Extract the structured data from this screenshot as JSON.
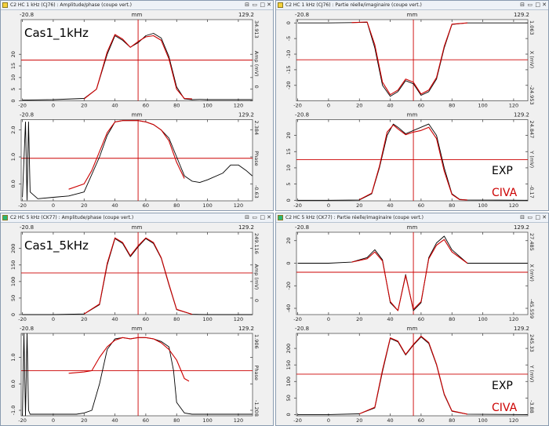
{
  "windows": [
    {
      "title": "C2 HC 1 kHz (CJ76) : Amplitude/phase (coupe vert.)",
      "icon_color": "#f5d13c",
      "panels": [
        {
          "xmin": "-20.8",
          "xunit": "mm",
          "xmax": "129.2",
          "ytop": "34.913",
          "ybottom": "0",
          "yname": "Amp (mV)",
          "yticks": [
            "20",
            "15",
            "10",
            "5",
            "0"
          ],
          "xticks": [
            "-20",
            "0",
            "20",
            "40",
            "60",
            "80",
            "100",
            "120"
          ],
          "annotation": "Cas1_1kHz",
          "annotation_color": "#000000"
        },
        {
          "xmin": "-20.8",
          "xunit": "mm",
          "xmax": "129.2",
          "ytop": "2.384",
          "ybottom": "-0.63",
          "yname": "Phase",
          "yticks": [
            "2.0",
            "1.0",
            "0.0"
          ],
          "xticks": [
            "-20",
            "0",
            "20",
            "40",
            "60",
            "80",
            "100",
            "120"
          ]
        }
      ]
    },
    {
      "title": "C2 HC 1 kHz (CJ76) : Partie réelle/imaginaire (coupe vert.)",
      "icon_color": "#f5d13c",
      "panels": [
        {
          "xmin": "-20.8",
          "xunit": "mm",
          "xmax": "129.2",
          "ytop": "1.063",
          "ybottom": "-24.953",
          "yname": "X (mV)",
          "yticks": [
            "0",
            "-5",
            "-10",
            "-15",
            "-20"
          ],
          "xticks": [
            "-20",
            "0",
            "20",
            "40",
            "60",
            "80",
            "100",
            "120"
          ]
        },
        {
          "xmin": "-20.8",
          "xunit": "mm",
          "xmax": "129.2",
          "ytop": "24.847",
          "ybottom": "-0.17",
          "yname": "Y (mV)",
          "yticks": [
            "20",
            "15",
            "10",
            "5",
            "0"
          ],
          "xticks": [
            "-20",
            "0",
            "20",
            "40",
            "60",
            "80",
            "100",
            "120"
          ],
          "legend_exp": "EXP",
          "legend_civa": "CIVA"
        }
      ]
    },
    {
      "title": "C2 HC 5 kHz (CK77) : Amplitude/phase (coupe vert.)",
      "icon_color": "#2bb673",
      "panels": [
        {
          "xmin": "-20.8",
          "xunit": "mm",
          "xmax": "129.2",
          "ytop": "249.116",
          "ybottom": "0",
          "yname": "Amp (mV)",
          "yticks": [
            "200",
            "150",
            "100",
            "50",
            "0"
          ],
          "xticks": [
            "-20",
            "0",
            "20",
            "40",
            "60",
            "80",
            "100",
            "120"
          ],
          "annotation": "Cas1_5kHz",
          "annotation_color": "#000000"
        },
        {
          "xmin": "-20.8",
          "xunit": "mm",
          "xmax": "129.2",
          "ytop": "1.906",
          "ybottom": "-1.208",
          "yname": "Phase",
          "yticks": [
            "1.0",
            "0.0",
            "-1.0"
          ],
          "xticks": [
            "-20",
            "0",
            "20",
            "40",
            "60",
            "80",
            "100",
            "120"
          ]
        }
      ]
    },
    {
      "title": "C2 HC 5 kHz (CK77) : Partie réelle/imaginaire (coupe vert.)",
      "icon_color": "#2bb673",
      "panels": [
        {
          "xmin": "-20.8",
          "xunit": "mm",
          "xmax": "129.2",
          "ytop": "27.485",
          "ybottom": "-45.559",
          "yname": "X (mV)",
          "yticks": [
            "20",
            "0",
            "-20",
            "-40"
          ],
          "xticks": [
            "-20",
            "0",
            "20",
            "40",
            "60",
            "80",
            "100",
            "120"
          ]
        },
        {
          "xmin": "-20.8",
          "xunit": "mm",
          "xmax": "129.2",
          "ytop": "245.33",
          "ybottom": "-3.88",
          "yname": "Y (mV)",
          "yticks": [
            "200",
            "150",
            "100",
            "50",
            "0"
          ],
          "xticks": [
            "-20",
            "0",
            "20",
            "40",
            "60",
            "80",
            "100",
            "120"
          ],
          "legend_exp": "EXP",
          "legend_civa": "CIVA"
        }
      ]
    }
  ],
  "colors": {
    "exp": "#000000",
    "civa": "#cc0000",
    "cursor": "#cc0000"
  },
  "chart_data": [
    {
      "type": "line",
      "title": "C2 HC 1 kHz (CJ76) : Amplitude/phase (coupe vert.)",
      "xlabel": "mm",
      "ylabel": "Amp (mV)",
      "xlim": [
        -20.8,
        129.2
      ],
      "ylim": [
        0,
        34.913
      ],
      "series": [
        {
          "name": "EXP",
          "x": [
            -20,
            0,
            20,
            28,
            35,
            40,
            45,
            50,
            55,
            60,
            65,
            70,
            75,
            80,
            85,
            90,
            95,
            100,
            110,
            120,
            129
          ],
          "y": [
            0.3,
            0.5,
            1,
            5,
            20,
            28,
            26,
            23,
            25,
            28,
            29,
            27,
            19,
            6,
            0.8,
            0.5,
            0.6,
            0.5,
            0.5,
            0.5,
            0.5
          ]
        },
        {
          "name": "CIVA",
          "x": [
            20,
            28,
            35,
            40,
            45,
            50,
            55,
            60,
            65,
            70,
            75,
            80,
            85,
            90
          ],
          "y": [
            0.8,
            5,
            21,
            28.5,
            26.5,
            23,
            25.5,
            27.5,
            28,
            26,
            18,
            5,
            1,
            0.8
          ]
        }
      ],
      "cursors": {
        "x": 55,
        "y": 17.5
      }
    },
    {
      "type": "line",
      "title": "",
      "xlabel": "mm",
      "ylabel": "Phase",
      "xlim": [
        -20.8,
        129.2
      ],
      "ylim": [
        -0.63,
        2.384
      ],
      "series": [
        {
          "name": "EXP",
          "x": [
            -20,
            -18,
            -17,
            -16,
            -15,
            -10,
            0,
            10,
            20,
            30,
            35,
            40,
            45,
            50,
            55,
            60,
            65,
            70,
            75,
            80,
            85,
            90,
            95,
            100,
            110,
            115,
            120,
            125,
            129
          ],
          "y": [
            -0.5,
            2.3,
            -0.6,
            2.3,
            -0.3,
            -0.55,
            -0.5,
            -0.45,
            -0.3,
            1.0,
            1.8,
            2.3,
            2.35,
            2.35,
            2.35,
            2.3,
            2.2,
            2.0,
            1.7,
            1.0,
            0.3,
            0.1,
            0.05,
            0.15,
            0.4,
            0.7,
            0.7,
            0.5,
            0.3
          ]
        },
        {
          "name": "CIVA",
          "x": [
            10,
            20,
            25,
            30,
            35,
            40,
            45,
            50,
            55,
            60,
            65,
            70,
            75,
            80,
            85
          ],
          "y": [
            -0.2,
            0.0,
            0.5,
            1.2,
            1.9,
            2.3,
            2.35,
            2.35,
            2.35,
            2.3,
            2.2,
            2.0,
            1.6,
            0.8,
            0.2
          ]
        }
      ],
      "cursors": {
        "x": 55,
        "y": 0.95
      }
    },
    {
      "type": "line",
      "title": "C2 HC 1 kHz (CJ76) : Partie réelle/imaginaire (coupe vert.)",
      "xlabel": "mm",
      "ylabel": "X (mV)",
      "xlim": [
        -20.8,
        129.2
      ],
      "ylim": [
        -24.953,
        1.063
      ],
      "series": [
        {
          "name": "EXP",
          "x": [
            -20,
            0,
            15,
            25,
            30,
            35,
            40,
            45,
            50,
            55,
            60,
            65,
            70,
            75,
            80,
            90,
            129
          ],
          "y": [
            0,
            0,
            0.1,
            0.2,
            -8,
            -20,
            -23.5,
            -22,
            -18.5,
            -19.5,
            -23.2,
            -22,
            -18,
            -8,
            -0.5,
            0,
            0
          ]
        },
        {
          "name": "CIVA",
          "x": [
            15,
            25,
            30,
            35,
            40,
            45,
            50,
            55,
            60,
            65,
            70,
            75,
            80,
            90
          ],
          "y": [
            0.1,
            0.3,
            -7,
            -19,
            -23,
            -21.5,
            -18,
            -19,
            -22.8,
            -21.5,
            -17.5,
            -7.5,
            -0.4,
            0
          ]
        }
      ],
      "cursors": {
        "x": 55,
        "y": -11.8
      }
    },
    {
      "type": "line",
      "title": "",
      "xlabel": "mm",
      "ylabel": "Y (mV)",
      "xlim": [
        -20.8,
        129.2
      ],
      "ylim": [
        -0.17,
        24.847
      ],
      "series": [
        {
          "name": "EXP",
          "x": [
            -20,
            0,
            20,
            28,
            33,
            38,
            42,
            45,
            50,
            55,
            60,
            65,
            70,
            75,
            80,
            85,
            90,
            129
          ],
          "y": [
            0,
            0,
            0.1,
            2,
            10,
            20,
            23.5,
            22.5,
            20.5,
            21.5,
            22.5,
            23.5,
            20,
            10,
            2,
            0.3,
            0.1,
            0
          ]
        },
        {
          "name": "CIVA",
          "x": [
            20,
            28,
            33,
            38,
            42,
            45,
            50,
            55,
            60,
            65,
            70,
            75,
            80,
            85,
            90
          ],
          "y": [
            0.2,
            2.2,
            10.5,
            21,
            23.2,
            22,
            20.2,
            21,
            21.5,
            22.5,
            19,
            9,
            1.8,
            0.2,
            0.1
          ]
        }
      ],
      "cursors": {
        "x": 55,
        "y": 12.5
      }
    },
    {
      "type": "line",
      "title": "C2 HC 5 kHz (CK77) : Amplitude/phase (coupe vert.)",
      "xlabel": "mm",
      "ylabel": "Amp (mV)",
      "xlim": [
        -20.8,
        129.2
      ],
      "ylim": [
        0,
        249.116
      ],
      "series": [
        {
          "name": "EXP",
          "x": [
            -20,
            0,
            20,
            30,
            35,
            40,
            45,
            50,
            55,
            60,
            65,
            70,
            75,
            80,
            90,
            100,
            129
          ],
          "y": [
            0,
            0,
            2,
            30,
            150,
            230,
            215,
            175,
            205,
            230,
            215,
            170,
            90,
            15,
            1,
            0,
            0
          ]
        },
        {
          "name": "CIVA",
          "x": [
            20,
            30,
            35,
            40,
            45,
            50,
            55,
            60,
            65,
            70,
            75,
            80,
            90
          ],
          "y": [
            2,
            32,
            155,
            232,
            218,
            178,
            208,
            232,
            218,
            172,
            92,
            16,
            1
          ]
        }
      ],
      "cursors": {
        "x": 55,
        "y": 126
      }
    },
    {
      "type": "line",
      "title": "",
      "xlabel": "mm",
      "ylabel": "Phase",
      "xlim": [
        -20.8,
        129.2
      ],
      "ylim": [
        -1.208,
        1.906
      ],
      "series": [
        {
          "name": "EXP",
          "x": [
            -20,
            -19,
            -18,
            -17,
            -16,
            -15,
            0,
            15,
            20,
            25,
            30,
            35,
            40,
            45,
            50,
            55,
            60,
            65,
            70,
            75,
            78,
            80,
            85,
            90,
            100,
            115,
            120,
            125,
            129
          ],
          "y": [
            -1.2,
            1.9,
            -1.2,
            1.9,
            -1.0,
            -1.15,
            -1.15,
            -1.15,
            -1.1,
            -1.0,
            0.0,
            1.3,
            1.7,
            1.75,
            1.7,
            1.75,
            1.75,
            1.7,
            1.6,
            1.4,
            0.5,
            -0.7,
            -1.1,
            -1.15,
            -1.15,
            -1.15,
            -1.15,
            -1.15,
            -1.15
          ]
        },
        {
          "name": "CIVA",
          "x": [
            10,
            20,
            25,
            30,
            35,
            40,
            45,
            50,
            55,
            60,
            65,
            70,
            75,
            80,
            85,
            88
          ],
          "y": [
            0.4,
            0.45,
            0.5,
            1.0,
            1.4,
            1.65,
            1.75,
            1.7,
            1.75,
            1.75,
            1.7,
            1.55,
            1.3,
            0.9,
            0.2,
            0.1
          ]
        }
      ],
      "cursors": {
        "x": 55,
        "y": 0.5
      }
    },
    {
      "type": "line",
      "title": "C2 HC 5 kHz (CK77) : Partie réelle/imaginaire (coupe vert.)",
      "xlabel": "mm",
      "ylabel": "X (mV)",
      "xlim": [
        -20.8,
        129.2
      ],
      "ylim": [
        -45.559,
        27.485
      ],
      "series": [
        {
          "name": "EXP",
          "x": [
            -20,
            0,
            15,
            25,
            30,
            35,
            40,
            45,
            50,
            55,
            60,
            65,
            70,
            75,
            80,
            90,
            129
          ],
          "y": [
            0,
            0,
            1,
            5,
            12,
            3,
            -35,
            -42,
            -10,
            -42,
            -35,
            5,
            18,
            24,
            12,
            0,
            0
          ]
        },
        {
          "name": "CIVA",
          "x": [
            15,
            25,
            30,
            35,
            40,
            45,
            50,
            55,
            60,
            65,
            70,
            75,
            80,
            90
          ],
          "y": [
            1,
            4,
            10,
            2,
            -34,
            -42,
            -11,
            -41,
            -34,
            4,
            16,
            21,
            10,
            0
          ]
        }
      ],
      "cursors": {
        "x": 55,
        "y": -8
      }
    },
    {
      "type": "line",
      "title": "",
      "xlabel": "mm",
      "ylabel": "Y (mV)",
      "xlim": [
        -20.8,
        129.2
      ],
      "ylim": [
        -3.88,
        245.33
      ],
      "series": [
        {
          "name": "EXP",
          "x": [
            -20,
            0,
            20,
            30,
            35,
            40,
            45,
            50,
            55,
            60,
            65,
            70,
            75,
            80,
            90,
            129
          ],
          "y": [
            0,
            0,
            2,
            20,
            130,
            230,
            220,
            180,
            210,
            235,
            215,
            150,
            60,
            10,
            1,
            0
          ]
        },
        {
          "name": "CIVA",
          "x": [
            20,
            30,
            35,
            40,
            45,
            50,
            55,
            60,
            65,
            70,
            75,
            80,
            90
          ],
          "y": [
            2,
            22,
            135,
            232,
            222,
            182,
            212,
            237,
            218,
            152,
            62,
            11,
            1
          ]
        }
      ],
      "cursors": {
        "x": 55,
        "y": 122
      }
    }
  ]
}
